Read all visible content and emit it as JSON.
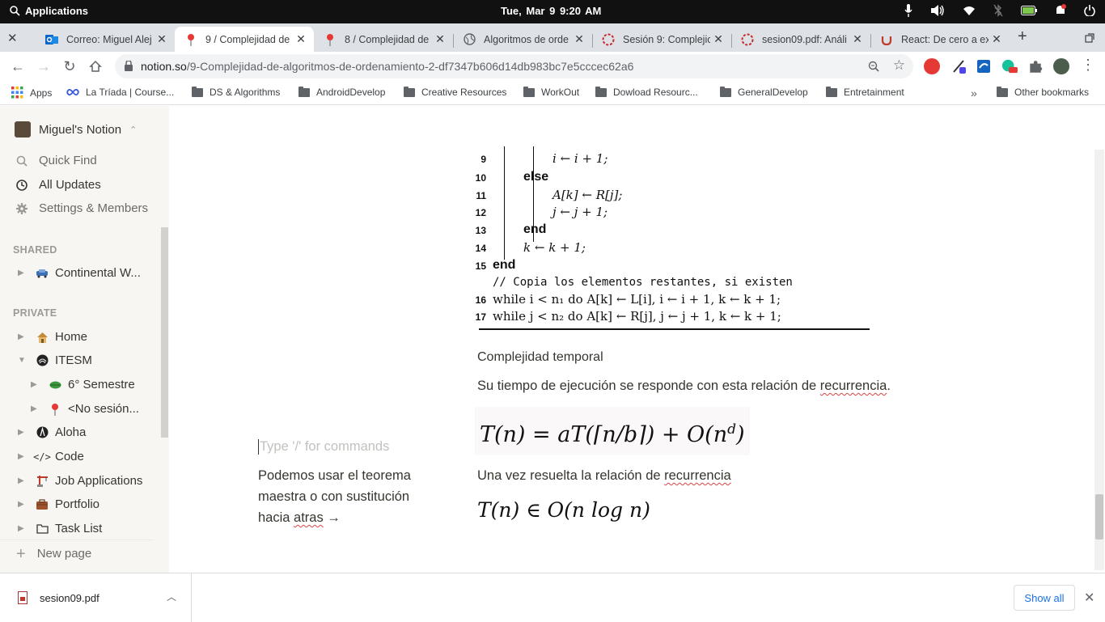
{
  "system_bar": {
    "applications_label": "Applications",
    "clock": "Tue, Mar  9     9:20 AM"
  },
  "tabs": [
    {
      "label": "Correo: Miguel Alej",
      "icon": "outlook-icon",
      "active": false
    },
    {
      "label": "9 / Complejidad de",
      "icon": "pushpin-icon",
      "active": true
    },
    {
      "label": "8 / Complejidad de",
      "icon": "pushpin-icon",
      "active": false
    },
    {
      "label": "Algoritmos de orde",
      "icon": "globe-icon",
      "active": false
    },
    {
      "label": "Sesión 9: Complejic",
      "icon": "loading-icon",
      "active": false
    },
    {
      "label": "sesion09.pdf: Análi",
      "icon": "loading-icon",
      "active": false
    },
    {
      "label": "React: De cero a ex",
      "icon": "udemy-icon",
      "active": false
    }
  ],
  "address_bar": {
    "host": "notion.so",
    "path": "/9-Complejidad-de-algoritmos-de-ordenamiento-2-df7347b606d14db983bc7e5cccec62a6"
  },
  "bookmarks": [
    {
      "label": "Apps",
      "icon": "apps-grid-icon"
    },
    {
      "label": "La Tríada | Course...",
      "icon": "infinity-icon"
    },
    {
      "label": "DS & Algorithms",
      "icon": "folder-icon"
    },
    {
      "label": "AndroidDevelop",
      "icon": "folder-icon"
    },
    {
      "label": "Creative Resources",
      "icon": "folder-icon"
    },
    {
      "label": "WorkOut",
      "icon": "folder-icon"
    },
    {
      "label": "Dowload Resourc...",
      "icon": "folder-icon"
    },
    {
      "label": "GeneralDevelop",
      "icon": "folder-icon"
    },
    {
      "label": "Entretainment",
      "icon": "folder-icon"
    }
  ],
  "other_bookmarks": "Other bookmarks",
  "sidebar": {
    "workspace": "Miguel's Notion",
    "quick_find": "Quick Find",
    "all_updates": "All Updates",
    "settings": "Settings & Members",
    "shared_header": "SHARED",
    "private_header": "PRIVATE",
    "shared_pages": [
      {
        "label": "Continental W...",
        "icon": "car-icon"
      }
    ],
    "private_pages": [
      {
        "label": "Home",
        "icon": "house-icon",
        "indent": 0,
        "expanded": false
      },
      {
        "label": "ITESM",
        "icon": "itesm-logo-icon",
        "indent": 0,
        "expanded": true
      },
      {
        "label": "6° Semestre",
        "icon": "leaf-icon",
        "indent": 1,
        "expanded": false
      },
      {
        "label": "<No sesión...",
        "icon": "pushpin-icon",
        "indent": 1,
        "expanded": false
      },
      {
        "label": "Aloha",
        "icon": "aloha-icon",
        "indent": 0,
        "expanded": false
      },
      {
        "label": "Code",
        "icon": "code-icon",
        "indent": 0,
        "expanded": false
      },
      {
        "label": "Job Applications",
        "icon": "crane-icon",
        "indent": 0,
        "expanded": false
      },
      {
        "label": "Portfolio",
        "icon": "briefcase-icon",
        "indent": 0,
        "expanded": false
      },
      {
        "label": "Task List",
        "icon": "folder-outline-icon",
        "indent": 0,
        "expanded": false
      }
    ],
    "new_page": "New page"
  },
  "content": {
    "algorithm_lines": [
      {
        "num": "9",
        "text": "i ← i + 1;"
      },
      {
        "num": "10",
        "text": "else"
      },
      {
        "num": "11",
        "text": "A[k] ← R[j];"
      },
      {
        "num": "12",
        "text": "j ← j + 1;"
      },
      {
        "num": "13",
        "text": "end"
      },
      {
        "num": "14",
        "text": "k ← k + 1;"
      },
      {
        "num": "15",
        "text": "end"
      },
      {
        "num": "",
        "text": "// Copia los elementos restantes, si existen"
      },
      {
        "num": "16",
        "text": "while i < n₁ do A[k] ← L[i],  i ← i + 1,  k ← k + 1;"
      },
      {
        "num": "17",
        "text": "while j < n₂ do A[k] ← R[j],  j ← j + 1,  k ← k + 1;"
      }
    ],
    "complexity_title": "Complejidad temporal",
    "recurrence_text_before": "Su tiempo de ejecución se responde con esta relación de ",
    "recurrence_word": "recurrencia",
    "recurrence_text_after": ".",
    "formula1": "T(n) = aT(⌈n/b⌉) + O(n",
    "formula1_exp": "d",
    "formula1_end": ")",
    "solved_text": "Una vez resuelta la relación de ",
    "solved_word": "recurrencia",
    "formula2": "T(n) ∈ O(n log n)",
    "placeholder": "Type '/' for commands",
    "aside_text": "Podemos usar el teorema maestra o con sustitución hacia ",
    "aside_word": "atras",
    "aside_arrow": " →"
  },
  "downloads": {
    "file": "sesion09.pdf",
    "show_all": "Show all"
  }
}
